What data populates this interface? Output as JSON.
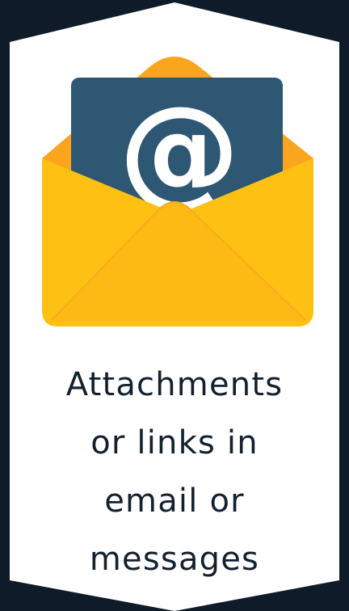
{
  "icon": {
    "name": "email-envelope-at-icon",
    "symbol": "@"
  },
  "caption": {
    "lines": [
      "Attachments",
      "or links in",
      "email or",
      "messages"
    ]
  },
  "colors": {
    "background": "#0f1b29",
    "panel": "#ffffff",
    "envelope_front": "#fec013",
    "envelope_flap": "#fba51e",
    "letter": "#2e5774",
    "symbol": "#ffffff",
    "text": "#13202e"
  }
}
